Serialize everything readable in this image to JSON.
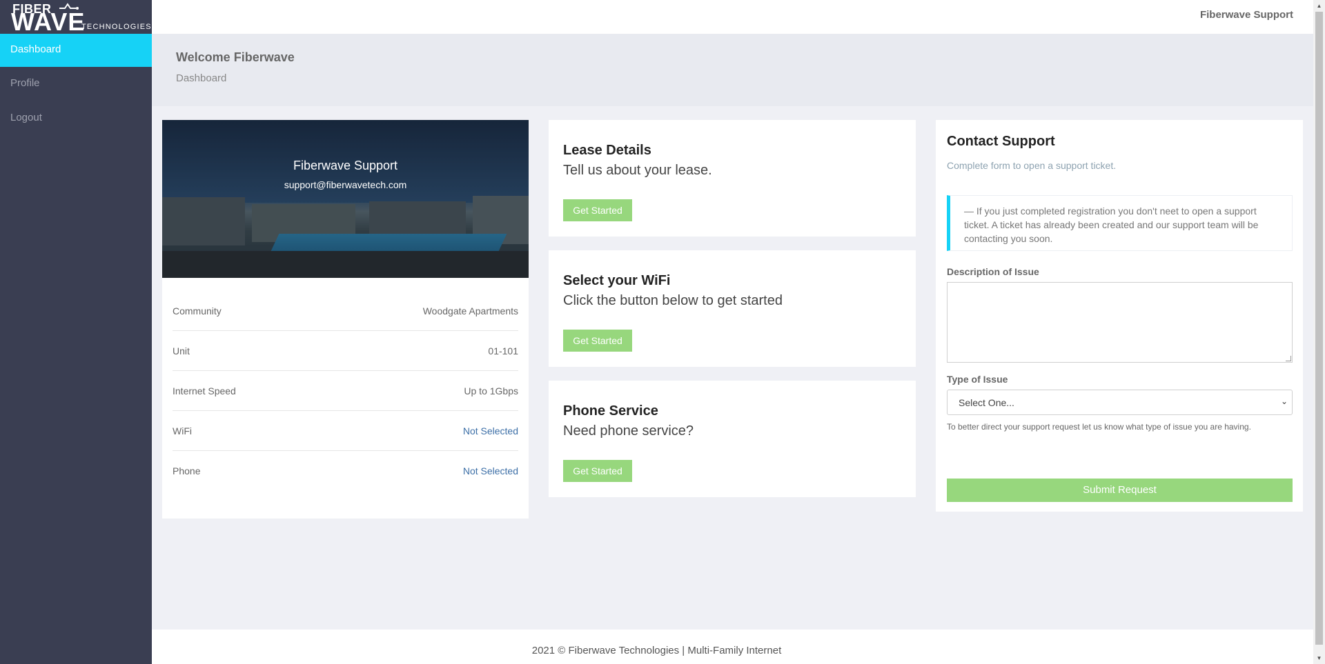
{
  "brand": {
    "logo_top": "FIBER",
    "logo_main": "WAVE",
    "logo_sub": "TECHNOLOGIES"
  },
  "sidebar": {
    "items": [
      {
        "label": "Dashboard",
        "active": true
      },
      {
        "label": "Profile",
        "active": false
      },
      {
        "label": "Logout",
        "active": false
      }
    ]
  },
  "topbar": {
    "user": "Fiberwave Support"
  },
  "header": {
    "title": "Welcome Fiberwave",
    "breadcrumb": "Dashboard"
  },
  "profile": {
    "name": "Fiberwave Support",
    "email": "support@fiberwavetech.com",
    "rows": [
      {
        "label": "Community",
        "value": "Woodgate Apartments"
      },
      {
        "label": "Unit",
        "value": "01-101"
      },
      {
        "label": "Internet Speed",
        "value": "Up to 1Gbps"
      },
      {
        "label": "WiFi",
        "value": "Not Selected"
      },
      {
        "label": "Phone",
        "value": "Not Selected"
      }
    ]
  },
  "services": [
    {
      "title": "Lease Details",
      "subtitle": "Tell us about your lease.",
      "button": "Get Started"
    },
    {
      "title": "Select your WiFi",
      "subtitle": "Click the button below to get started",
      "button": "Get Started"
    },
    {
      "title": "Phone Service",
      "subtitle": "Need phone service?",
      "button": "Get Started"
    }
  ],
  "contact": {
    "title": "Contact Support",
    "subtitle": "Complete form to open a support ticket.",
    "notice": "— If you just completed registration you don't neet to open a support ticket. A ticket has already been created and our support team will be contacting you soon.",
    "description_label": "Description of Issue",
    "description_value": "",
    "type_label": "Type of Issue",
    "type_selected": "Select One...",
    "help": "To better direct your support request let us know what type of issue you are having.",
    "submit": "Submit Request"
  },
  "footer": {
    "text": "2021 © Fiberwave Technologies | Multi-Family Internet"
  },
  "colors": {
    "sidebar": "#3a3e52",
    "active": "#16d2f6",
    "button": "#97d77d",
    "link": "#3c6fa7"
  }
}
